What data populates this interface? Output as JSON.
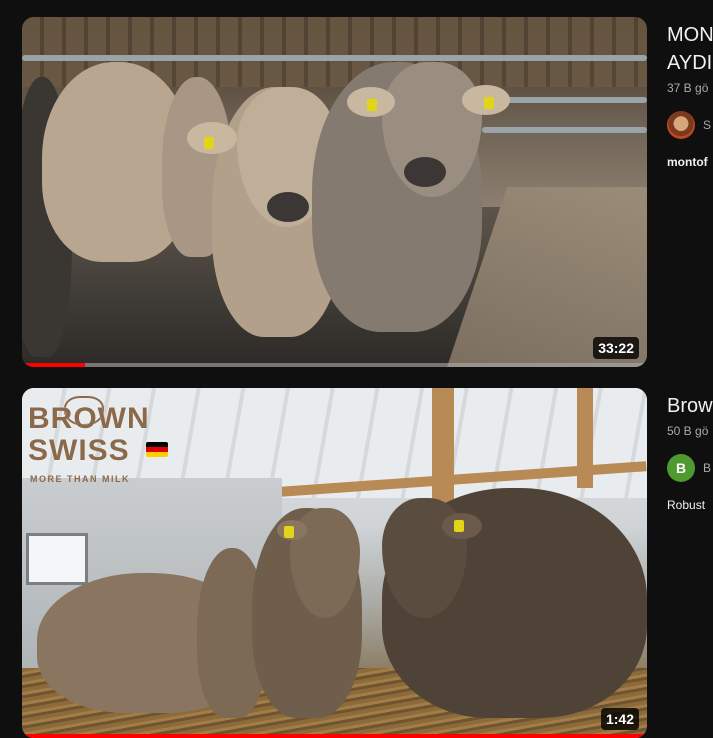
{
  "videos": [
    {
      "title": "MONTOFON AYDIN",
      "title_line_1": "MON",
      "title_line_2": "AYDI",
      "stats": "37 B gö",
      "channel_initial": "",
      "channel_name": "S",
      "description": "montof",
      "duration": "33:22",
      "progress": 0.1,
      "thumbnail_icon": "barn-cows-thumbnail"
    },
    {
      "title_line_1": "Brow",
      "stats": "50 B gö",
      "channel_initial": "B",
      "channel_name": "B",
      "description": "Robust",
      "duration": "1:42",
      "progress": 1.0,
      "thumbnail_logo": {
        "line_1": "BROWN",
        "line_2": "SWISS",
        "tagline": "MORE THAN MILK"
      }
    }
  ],
  "colors": {
    "background": "#0f0f0f",
    "progress": "#ff0000",
    "secondary_text": "#aaaaaa",
    "channel_avatar_2": "#4e9a2f"
  }
}
